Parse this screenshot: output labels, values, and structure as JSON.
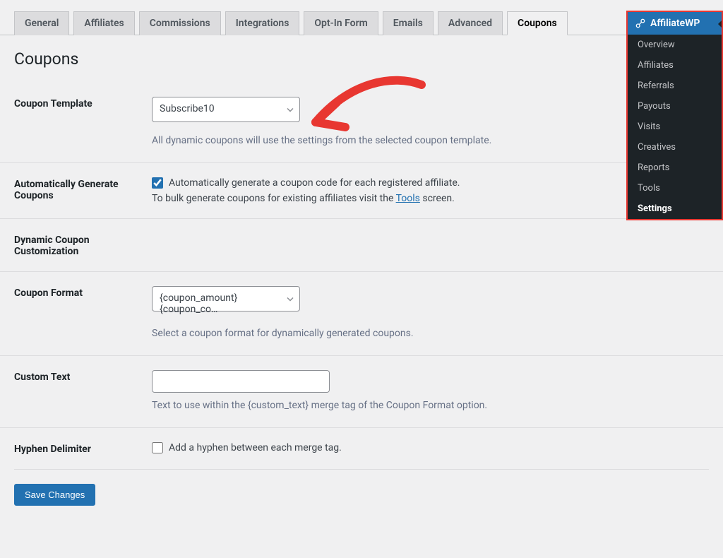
{
  "tabs": {
    "items": [
      {
        "label": "General",
        "active": false
      },
      {
        "label": "Affiliates",
        "active": false
      },
      {
        "label": "Commissions",
        "active": false
      },
      {
        "label": "Integrations",
        "active": false
      },
      {
        "label": "Opt-In Form",
        "active": false
      },
      {
        "label": "Emails",
        "active": false
      },
      {
        "label": "Advanced",
        "active": false
      },
      {
        "label": "Coupons",
        "active": true
      }
    ]
  },
  "page": {
    "title": "Coupons"
  },
  "rows": {
    "coupon_template": {
      "label": "Coupon Template",
      "selected": "Subscribe10",
      "description": "All dynamic coupons will use the settings from the selected coupon template."
    },
    "auto_generate": {
      "label": "Automatically Generate Coupons",
      "checkbox_text": "Automatically generate a coupon code for each registered affiliate.",
      "checked": true,
      "help_prefix": "To bulk generate coupons for existing affiliates visit the ",
      "help_link": "Tools",
      "help_suffix": " screen."
    },
    "dynamic_customization": {
      "label": "Dynamic Coupon Customization"
    },
    "coupon_format": {
      "label": "Coupon Format",
      "selected": "{coupon_amount}{coupon_co…",
      "description": "Select a coupon format for dynamically generated coupons."
    },
    "custom_text": {
      "label": "Custom Text",
      "value": "",
      "description": "Text to use within the {custom_text} merge tag of the Coupon Format option."
    },
    "hyphen": {
      "label": "Hyphen Delimiter",
      "checkbox_text": "Add a hyphen between each merge tag.",
      "checked": false
    }
  },
  "actions": {
    "save": "Save Changes"
  },
  "flyout": {
    "title": "AffiliateWP",
    "items": [
      {
        "label": "Overview",
        "current": false
      },
      {
        "label": "Affiliates",
        "current": false
      },
      {
        "label": "Referrals",
        "current": false
      },
      {
        "label": "Payouts",
        "current": false
      },
      {
        "label": "Visits",
        "current": false
      },
      {
        "label": "Creatives",
        "current": false
      },
      {
        "label": "Reports",
        "current": false
      },
      {
        "label": "Tools",
        "current": false
      },
      {
        "label": "Settings",
        "current": true
      }
    ]
  }
}
